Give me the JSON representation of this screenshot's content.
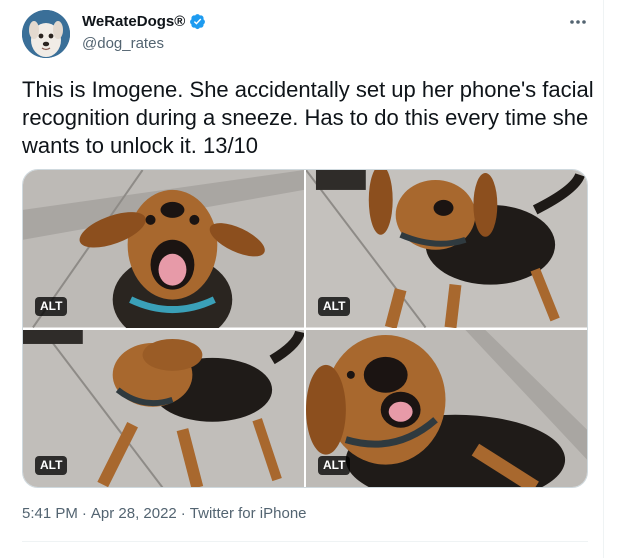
{
  "author": {
    "display_name": "WeRateDogs®",
    "handle": "@dog_rates",
    "avatar_icon": "dog-avatar-icon",
    "verified_icon": "verified-badge-icon",
    "verified_color": "#1d9bf0"
  },
  "more_icon": "more-options-icon",
  "tweet": {
    "text": "This is Imogene. She accidentally set up her phone's facial recognition during a sneeze. Has to do this every time she wants to unlock it. 13/10"
  },
  "media": {
    "photos": [
      {
        "alt_label": "ALT"
      },
      {
        "alt_label": "ALT"
      },
      {
        "alt_label": "ALT"
      },
      {
        "alt_label": "ALT"
      }
    ]
  },
  "meta": {
    "time": "5:41 PM",
    "separator1": "·",
    "date": "Apr 28, 2022",
    "separator2": "·",
    "source": "Twitter for iPhone"
  },
  "colors": {
    "text_primary": "#0f1419",
    "text_secondary": "#536471",
    "border": "#cfd9de"
  }
}
